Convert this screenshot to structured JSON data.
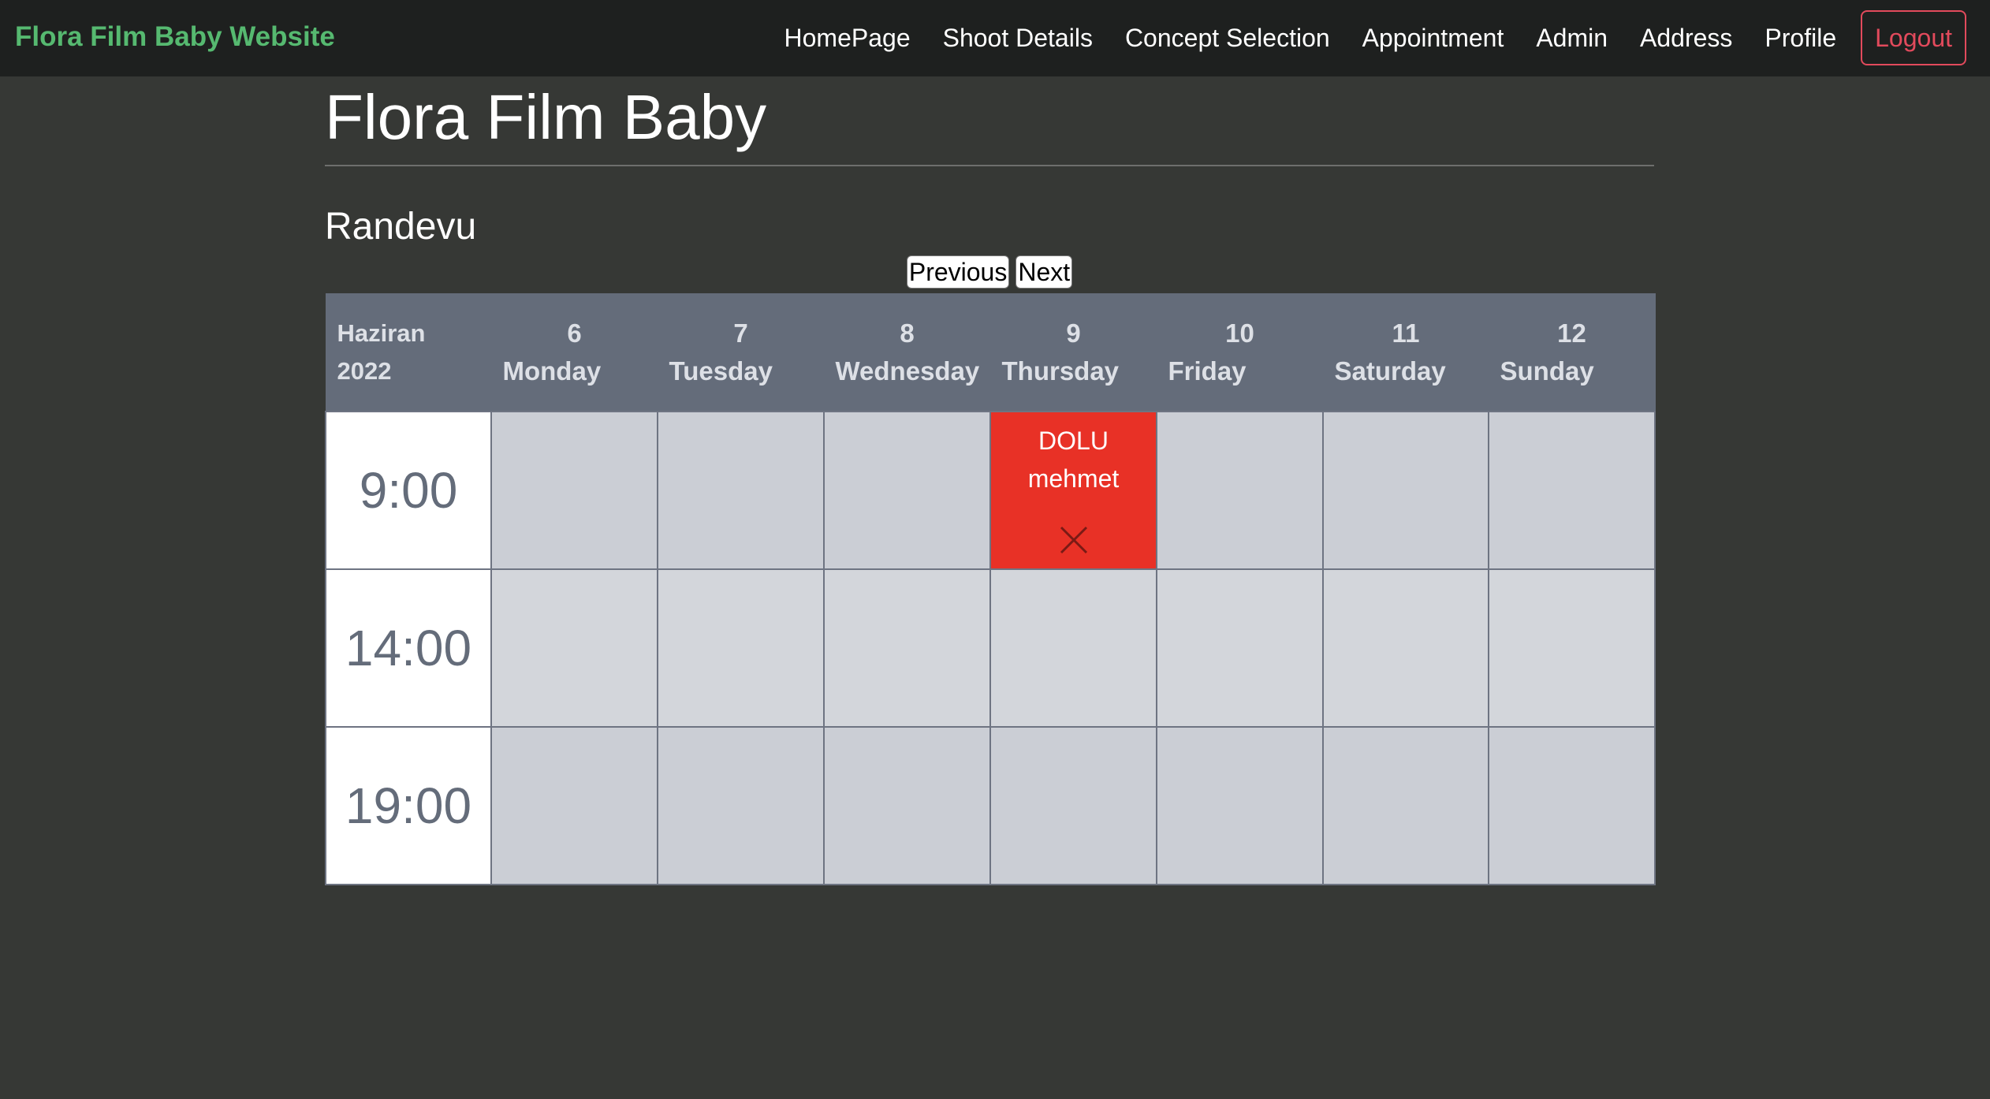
{
  "navbar": {
    "brand": "Flora Film Baby Website",
    "links": [
      "HomePage",
      "Shoot Details",
      "Concept Selection",
      "Appointment",
      "Admin",
      "Address",
      "Profile"
    ],
    "logout": "Logout"
  },
  "page": {
    "title": "Flora Film Baby",
    "section": "Randevu"
  },
  "pager": {
    "previous": "Previous",
    "next": "Next"
  },
  "calendar": {
    "month": "Haziran",
    "year": "2022",
    "days": [
      {
        "num": "6",
        "name": "Monday"
      },
      {
        "num": "7",
        "name": "Tuesday"
      },
      {
        "num": "8",
        "name": "Wednesday"
      },
      {
        "num": "9",
        "name": "Thursday"
      },
      {
        "num": "10",
        "name": "Friday"
      },
      {
        "num": "11",
        "name": "Saturday"
      },
      {
        "num": "12",
        "name": "Sunday"
      }
    ],
    "times": [
      "9:00",
      "14:00",
      "19:00"
    ],
    "booking": {
      "status": "DOLU",
      "name": "mehmet"
    }
  },
  "colors": {
    "background": "#363835",
    "navbar": "#1e201f",
    "brand": "#56b970",
    "logout": "#e24a5c",
    "header": "#646c7a",
    "booked": "#e83126"
  }
}
